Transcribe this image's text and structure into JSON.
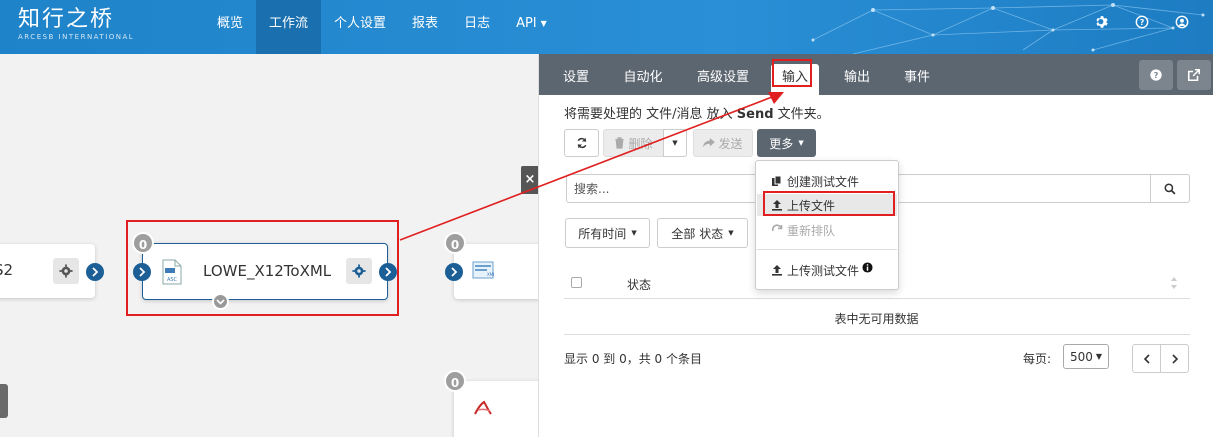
{
  "brand": {
    "name": "知行之桥",
    "subtitle": "ARCESB INTERNATIONAL"
  },
  "nav": {
    "items": [
      {
        "label": "概览"
      },
      {
        "label": "工作流"
      },
      {
        "label": "个人设置"
      },
      {
        "label": "报表"
      },
      {
        "label": "日志"
      },
      {
        "label": "API"
      }
    ],
    "active": "工作流"
  },
  "canvas": {
    "left_node": {
      "title": "S2"
    },
    "main_node": {
      "badge": "0",
      "title": "LOWE_X12ToXML"
    },
    "right_node": {
      "badge": "0"
    },
    "bottom_node": {
      "badge": "0"
    },
    "close_label": "×"
  },
  "panel": {
    "tabs": [
      {
        "label": "设置"
      },
      {
        "label": "自动化"
      },
      {
        "label": "高级设置"
      },
      {
        "label": "输入"
      },
      {
        "label": "输出"
      },
      {
        "label": "事件"
      }
    ],
    "active_tab": "输入",
    "description": {
      "prefix": "将需要处理的 文件/消息 放入 ",
      "folder": "Send",
      "suffix": " 文件夹。"
    },
    "toolbar": {
      "delete": "删除",
      "send": "发送",
      "more": "更多"
    },
    "search": {
      "placeholder": "搜索..."
    },
    "filters": {
      "time": "所有时间",
      "status": "全部 状态"
    },
    "table": {
      "columns": [
        "状态"
      ],
      "empty": "表中无可用数据"
    },
    "footer": {
      "info": "显示 0 到 0，共 0 个条目",
      "per_page_label": "每页:",
      "per_page_value": "500"
    }
  },
  "menu": {
    "items": [
      {
        "label": "创建测试文件",
        "state": "normal"
      },
      {
        "label": "上传文件",
        "state": "selected"
      },
      {
        "label": "重新排队",
        "state": "disabled"
      },
      {
        "label": "上传测试文件",
        "state": "normal"
      }
    ]
  },
  "colors": {
    "navbar": "#2a8fd6",
    "tabbar": "#5c6670",
    "highlight": "#e02020",
    "port": "#1b5f96"
  }
}
